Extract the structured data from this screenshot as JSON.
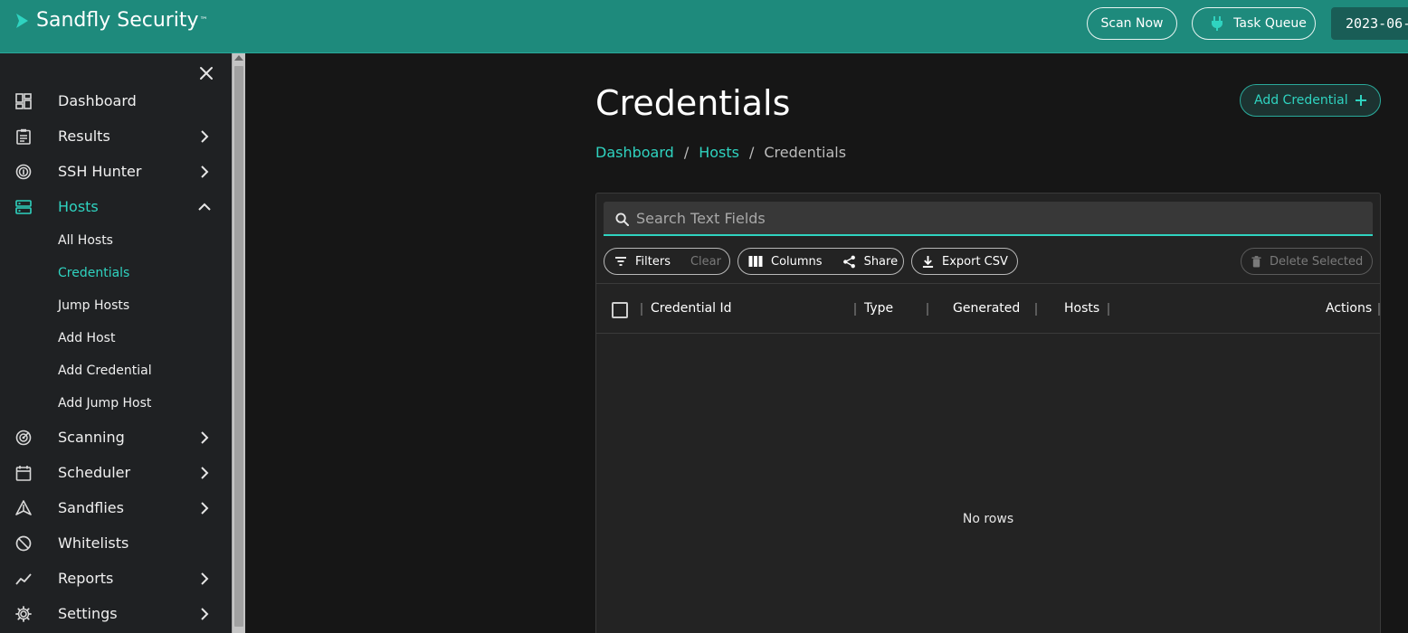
{
  "header": {
    "brand": "Sandfly Security",
    "brand_tm": "™",
    "scan_now": "Scan Now",
    "task_queue": "Task Queue",
    "date": "2023-06-"
  },
  "sidebar": {
    "items": [
      {
        "label": "Dashboard",
        "icon": "dashboard-icon"
      },
      {
        "label": "Results",
        "icon": "clipboard-icon"
      },
      {
        "label": "SSH Hunter",
        "icon": "fingerprint-icon"
      },
      {
        "label": "Hosts",
        "icon": "server-icon"
      },
      {
        "label": "Scanning",
        "icon": "radar-icon"
      },
      {
        "label": "Scheduler",
        "icon": "calendar-icon"
      },
      {
        "label": "Sandflies",
        "icon": "sandfly-icon"
      },
      {
        "label": "Whitelists",
        "icon": "block-icon"
      },
      {
        "label": "Reports",
        "icon": "trend-icon"
      },
      {
        "label": "Settings",
        "icon": "gear-icon"
      }
    ],
    "hosts_sub": [
      "All Hosts",
      "Credentials",
      "Jump Hosts",
      "Add Host",
      "Add Credential",
      "Add Jump Host"
    ]
  },
  "main": {
    "title": "Credentials",
    "add_button": "Add Credential",
    "breadcrumb": [
      "Dashboard",
      "Hosts",
      "Credentials"
    ],
    "breadcrumb_sep": "/",
    "search_placeholder": "Search Text Fields",
    "toolbar": {
      "filters": "Filters",
      "clear": "Clear",
      "columns": "Columns",
      "share": "Share",
      "export": "Export CSV",
      "delete": "Delete Selected"
    },
    "columns": [
      "Credential Id",
      "Type",
      "Generated",
      "Hosts",
      "Actions"
    ],
    "empty_text": "No rows"
  },
  "colors": {
    "accent": "#2fd3c0",
    "header": "#1e8a7c",
    "sidebar": "#1f2123",
    "background": "#161616"
  }
}
